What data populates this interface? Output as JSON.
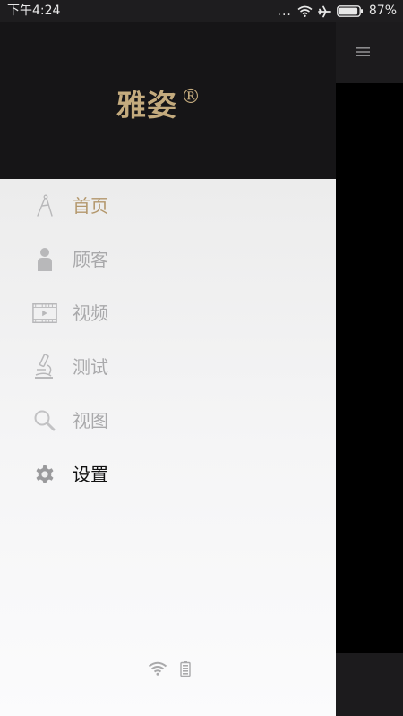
{
  "status_bar": {
    "time": "下午4:24",
    "dots": "...",
    "battery_percent": "87%",
    "icons": [
      "wifi-icon",
      "airplane-icon",
      "battery-icon"
    ]
  },
  "app": {
    "menu_icon": "hamburger-menu-icon"
  },
  "drawer": {
    "brand": "雅姿",
    "brand_mark": "®",
    "brand_color": "#c4ab7e",
    "menu_items": [
      {
        "label": "首页",
        "icon": "compass-icon",
        "state": "active"
      },
      {
        "label": "顾客",
        "icon": "person-icon",
        "state": "inactive"
      },
      {
        "label": "视频",
        "icon": "film-icon",
        "state": "inactive"
      },
      {
        "label": "测试",
        "icon": "microscope-icon",
        "state": "inactive"
      },
      {
        "label": "视图",
        "icon": "search-icon",
        "state": "inactive"
      },
      {
        "label": "设置",
        "icon": "gear-icon",
        "state": "dark"
      }
    ],
    "footer_icons": [
      "wifi-icon",
      "battery-icon"
    ]
  },
  "colors": {
    "active": "#b3976c",
    "inactive": "#a9a9ab",
    "dark_text": "#111111",
    "header_bg": "#161517"
  }
}
